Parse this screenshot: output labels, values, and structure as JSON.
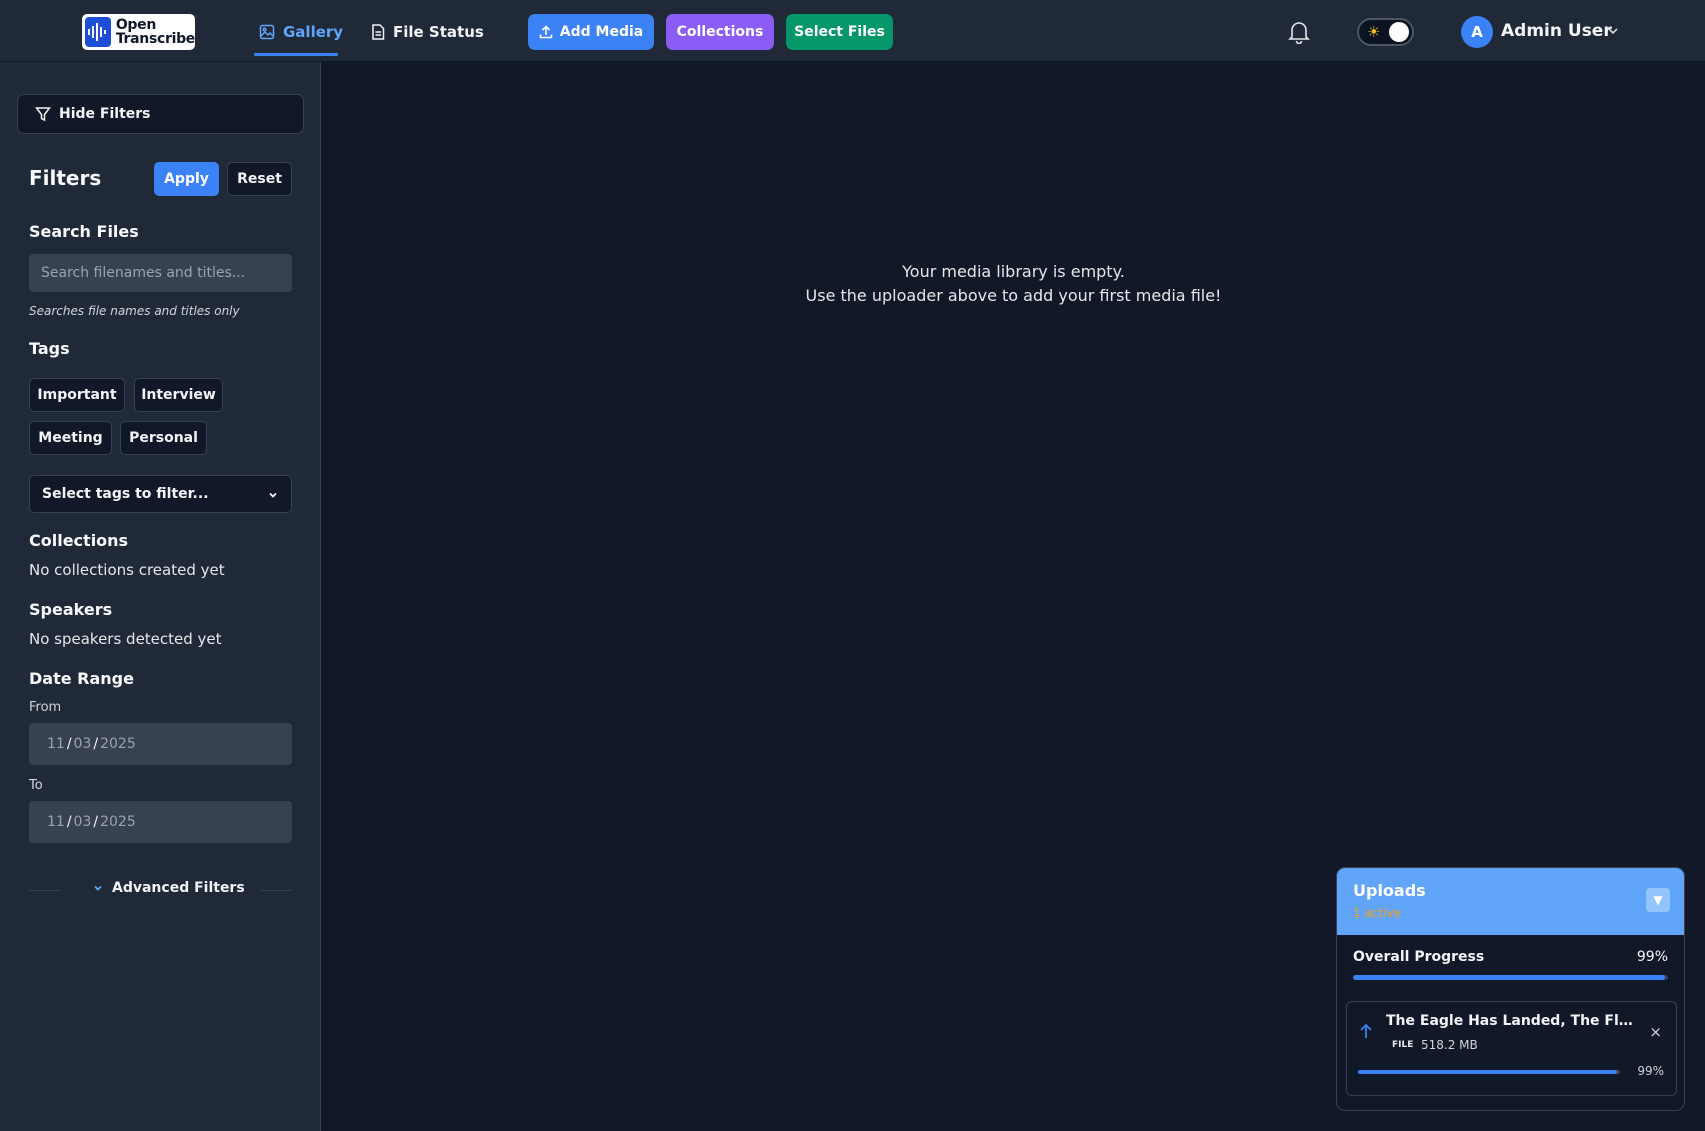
{
  "header": {
    "logo_line1": "Open",
    "logo_line2": "Transcribe",
    "nav": {
      "gallery": "Gallery",
      "file_status": "File Status"
    },
    "buttons": {
      "add_media": "Add Media",
      "collections": "Collections",
      "select_files": "Select Files"
    },
    "user": {
      "initial": "A",
      "name": "Admin User"
    },
    "icons": [
      "bell-icon",
      "sun-icon",
      "chevron-down-icon"
    ]
  },
  "sidebar": {
    "hide_filters": "Hide Filters",
    "title": "Filters",
    "apply": "Apply",
    "reset": "Reset",
    "search": {
      "title": "Search Files",
      "placeholder": "Search filenames and titles...",
      "hint": "Searches file names and titles only"
    },
    "tags": {
      "title": "Tags",
      "items": [
        "Important",
        "Interview",
        "Meeting",
        "Personal"
      ],
      "select_placeholder": "Select tags to filter..."
    },
    "collections": {
      "title": "Collections",
      "empty": "No collections created yet"
    },
    "speakers": {
      "title": "Speakers",
      "empty": "No speakers detected yet"
    },
    "date_range": {
      "title": "Date Range",
      "from_label": "From",
      "to_label": "To",
      "from": {
        "mm": "11",
        "dd": "03",
        "yyyy": "2025"
      },
      "to": {
        "mm": "11",
        "dd": "03",
        "yyyy": "2025"
      }
    },
    "advanced": "Advanced Filters"
  },
  "main": {
    "empty_line1": "Your media library is empty.",
    "empty_line2": "Use the uploader above to add your first media file!"
  },
  "uploads": {
    "title": "Uploads",
    "active": "1 active",
    "toggle_glyph": "▼",
    "overall_label": "Overall Progress",
    "overall_pct": "99%",
    "overall_progress": 0.99,
    "file": {
      "name": "The Eagle Has Landed, The Flight ...",
      "type": "FILE",
      "size": "518.2 MB",
      "pct": "99%",
      "progress": 0.99,
      "close_glyph": "×"
    }
  },
  "colors": {
    "accent": "#3b82f6",
    "collections": "#8b5cf6",
    "select_files": "#059669",
    "active_status": "#f59e0b"
  }
}
